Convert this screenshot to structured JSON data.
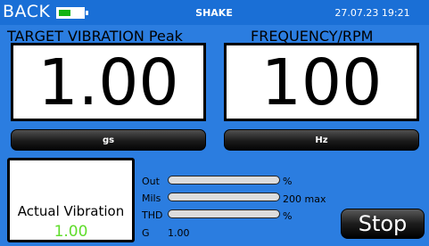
{
  "header": {
    "back_label": "BACK",
    "battery_level": 0.5,
    "battery_color": "#13b313",
    "title": "SHAKE",
    "datetime": "27.07.23 19:21"
  },
  "target": {
    "label": "TARGET VIBRATION  Peak",
    "value": "1.00",
    "unit_button": "gs"
  },
  "frequency": {
    "label": "FREQUENCY/RPM",
    "value": "100",
    "unit_button": "Hz"
  },
  "actual": {
    "label": "Actual Vibration",
    "value": "1.00",
    "value_color": "#5fdc2a"
  },
  "stats": {
    "out": {
      "label": "Out",
      "level": 0.0,
      "unit": "%"
    },
    "mils": {
      "label": "Mils",
      "level": 0.0,
      "unit": "200 max"
    },
    "thd": {
      "label": "THD",
      "level": 0.0,
      "unit": "%"
    },
    "g": {
      "label": "G",
      "value": "1.00"
    }
  },
  "stop_label": "Stop"
}
